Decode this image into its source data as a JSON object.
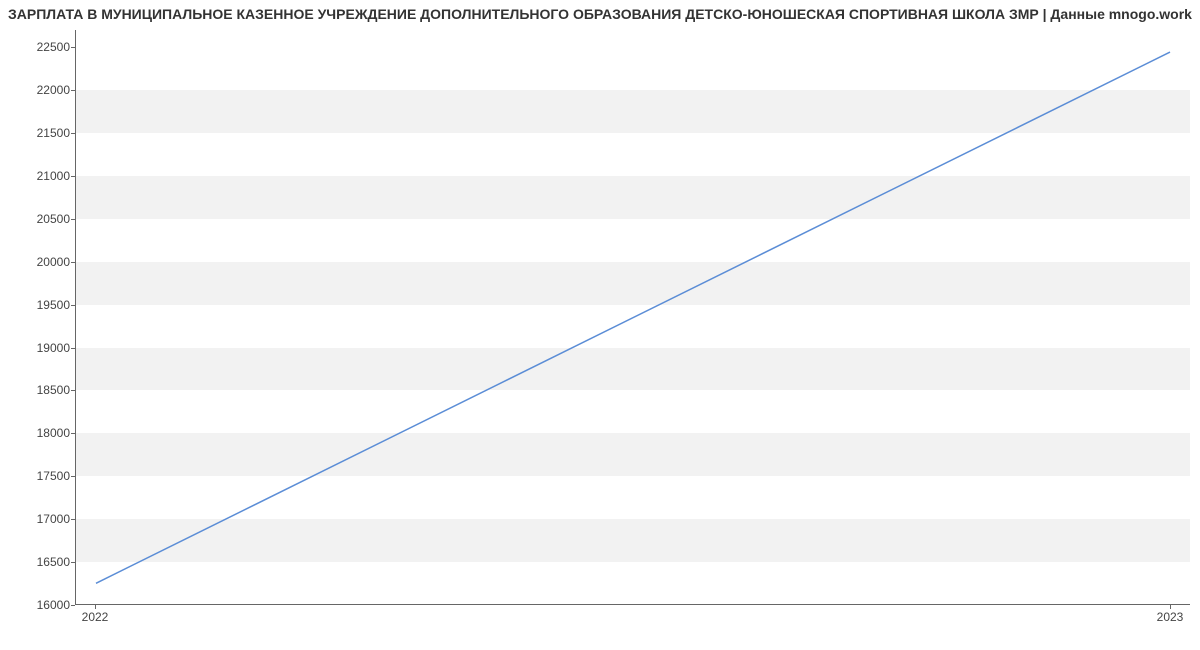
{
  "chart_data": {
    "type": "line",
    "title": "ЗАРПЛАТА В МУНИЦИПАЛЬНОЕ КАЗЕННОЕ УЧРЕЖДЕНИЕ ДОПОЛНИТЕЛЬНОГО ОБРАЗОВАНИЯ ДЕТСКО-ЮНОШЕСКАЯ СПОРТИВНАЯ ШКОЛА ЗМР | Данные mnogo.work",
    "x": [
      "2022",
      "2023"
    ],
    "values": [
      16242,
      22442
    ],
    "x_ticks": [
      "2022",
      "2023"
    ],
    "y_ticks": [
      16000,
      16500,
      17000,
      17500,
      18000,
      18500,
      19000,
      19500,
      20000,
      20500,
      21000,
      21500,
      22000,
      22500
    ],
    "ylim": [
      16000,
      22700
    ],
    "xlabel": "",
    "ylabel": "",
    "line_color": "#5b8dd6"
  }
}
